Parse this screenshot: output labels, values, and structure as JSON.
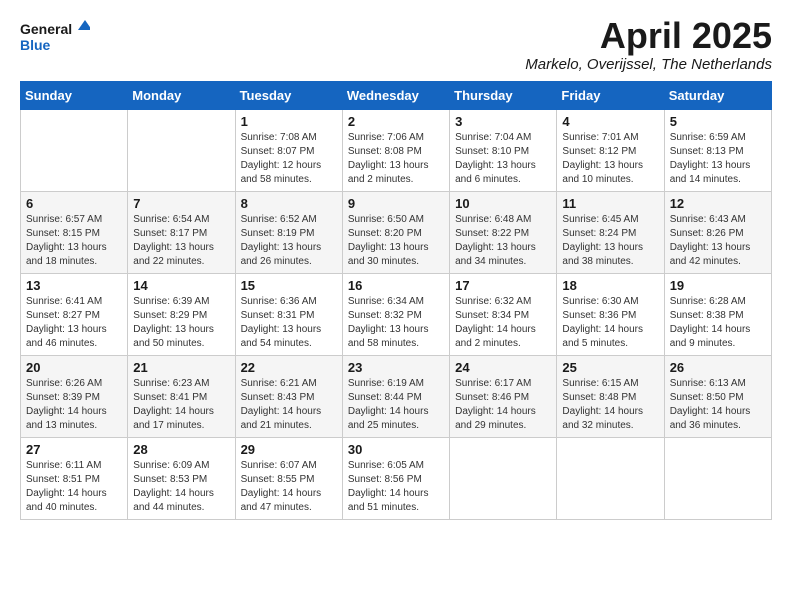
{
  "logo": {
    "line1": "General",
    "line2": "Blue"
  },
  "title": "April 2025",
  "location": "Markelo, Overijssel, The Netherlands",
  "days_of_week": [
    "Sunday",
    "Monday",
    "Tuesday",
    "Wednesday",
    "Thursday",
    "Friday",
    "Saturday"
  ],
  "weeks": [
    [
      {
        "day": "",
        "info": ""
      },
      {
        "day": "",
        "info": ""
      },
      {
        "day": "1",
        "info": "Sunrise: 7:08 AM\nSunset: 8:07 PM\nDaylight: 12 hours and 58 minutes."
      },
      {
        "day": "2",
        "info": "Sunrise: 7:06 AM\nSunset: 8:08 PM\nDaylight: 13 hours and 2 minutes."
      },
      {
        "day": "3",
        "info": "Sunrise: 7:04 AM\nSunset: 8:10 PM\nDaylight: 13 hours and 6 minutes."
      },
      {
        "day": "4",
        "info": "Sunrise: 7:01 AM\nSunset: 8:12 PM\nDaylight: 13 hours and 10 minutes."
      },
      {
        "day": "5",
        "info": "Sunrise: 6:59 AM\nSunset: 8:13 PM\nDaylight: 13 hours and 14 minutes."
      }
    ],
    [
      {
        "day": "6",
        "info": "Sunrise: 6:57 AM\nSunset: 8:15 PM\nDaylight: 13 hours and 18 minutes."
      },
      {
        "day": "7",
        "info": "Sunrise: 6:54 AM\nSunset: 8:17 PM\nDaylight: 13 hours and 22 minutes."
      },
      {
        "day": "8",
        "info": "Sunrise: 6:52 AM\nSunset: 8:19 PM\nDaylight: 13 hours and 26 minutes."
      },
      {
        "day": "9",
        "info": "Sunrise: 6:50 AM\nSunset: 8:20 PM\nDaylight: 13 hours and 30 minutes."
      },
      {
        "day": "10",
        "info": "Sunrise: 6:48 AM\nSunset: 8:22 PM\nDaylight: 13 hours and 34 minutes."
      },
      {
        "day": "11",
        "info": "Sunrise: 6:45 AM\nSunset: 8:24 PM\nDaylight: 13 hours and 38 minutes."
      },
      {
        "day": "12",
        "info": "Sunrise: 6:43 AM\nSunset: 8:26 PM\nDaylight: 13 hours and 42 minutes."
      }
    ],
    [
      {
        "day": "13",
        "info": "Sunrise: 6:41 AM\nSunset: 8:27 PM\nDaylight: 13 hours and 46 minutes."
      },
      {
        "day": "14",
        "info": "Sunrise: 6:39 AM\nSunset: 8:29 PM\nDaylight: 13 hours and 50 minutes."
      },
      {
        "day": "15",
        "info": "Sunrise: 6:36 AM\nSunset: 8:31 PM\nDaylight: 13 hours and 54 minutes."
      },
      {
        "day": "16",
        "info": "Sunrise: 6:34 AM\nSunset: 8:32 PM\nDaylight: 13 hours and 58 minutes."
      },
      {
        "day": "17",
        "info": "Sunrise: 6:32 AM\nSunset: 8:34 PM\nDaylight: 14 hours and 2 minutes."
      },
      {
        "day": "18",
        "info": "Sunrise: 6:30 AM\nSunset: 8:36 PM\nDaylight: 14 hours and 5 minutes."
      },
      {
        "day": "19",
        "info": "Sunrise: 6:28 AM\nSunset: 8:38 PM\nDaylight: 14 hours and 9 minutes."
      }
    ],
    [
      {
        "day": "20",
        "info": "Sunrise: 6:26 AM\nSunset: 8:39 PM\nDaylight: 14 hours and 13 minutes."
      },
      {
        "day": "21",
        "info": "Sunrise: 6:23 AM\nSunset: 8:41 PM\nDaylight: 14 hours and 17 minutes."
      },
      {
        "day": "22",
        "info": "Sunrise: 6:21 AM\nSunset: 8:43 PM\nDaylight: 14 hours and 21 minutes."
      },
      {
        "day": "23",
        "info": "Sunrise: 6:19 AM\nSunset: 8:44 PM\nDaylight: 14 hours and 25 minutes."
      },
      {
        "day": "24",
        "info": "Sunrise: 6:17 AM\nSunset: 8:46 PM\nDaylight: 14 hours and 29 minutes."
      },
      {
        "day": "25",
        "info": "Sunrise: 6:15 AM\nSunset: 8:48 PM\nDaylight: 14 hours and 32 minutes."
      },
      {
        "day": "26",
        "info": "Sunrise: 6:13 AM\nSunset: 8:50 PM\nDaylight: 14 hours and 36 minutes."
      }
    ],
    [
      {
        "day": "27",
        "info": "Sunrise: 6:11 AM\nSunset: 8:51 PM\nDaylight: 14 hours and 40 minutes."
      },
      {
        "day": "28",
        "info": "Sunrise: 6:09 AM\nSunset: 8:53 PM\nDaylight: 14 hours and 44 minutes."
      },
      {
        "day": "29",
        "info": "Sunrise: 6:07 AM\nSunset: 8:55 PM\nDaylight: 14 hours and 47 minutes."
      },
      {
        "day": "30",
        "info": "Sunrise: 6:05 AM\nSunset: 8:56 PM\nDaylight: 14 hours and 51 minutes."
      },
      {
        "day": "",
        "info": ""
      },
      {
        "day": "",
        "info": ""
      },
      {
        "day": "",
        "info": ""
      }
    ]
  ]
}
